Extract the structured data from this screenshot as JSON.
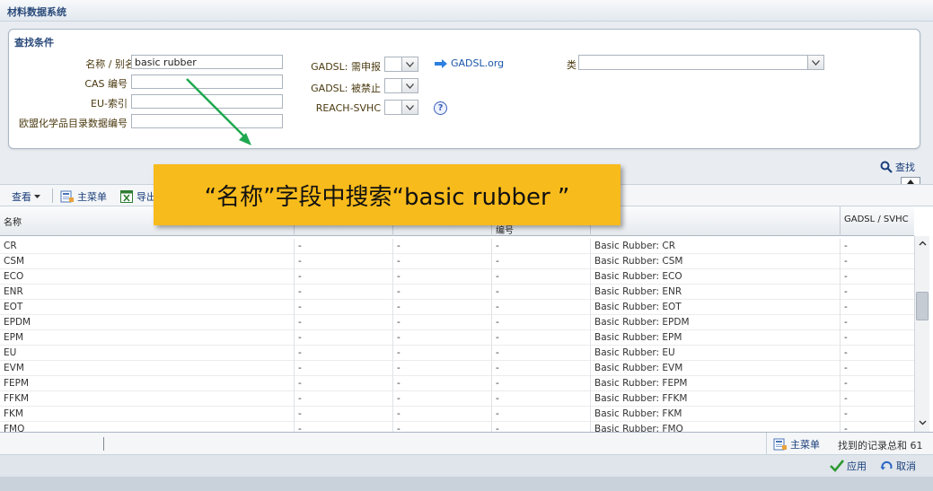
{
  "app": {
    "title": "材料数据系统"
  },
  "search": {
    "title": "查找条件",
    "name_label": "名称 / 别名",
    "name_value": "basic rubber",
    "cas_label": "CAS 编号",
    "eu_label": "EU-索引",
    "echa_label": "欧盟化学品目录数据编号",
    "gadsl_declare_label": "GADSL: 需申报",
    "gadsl_prohibited_label": "GADSL: 被禁止",
    "reach_label": "REACH-SVHC",
    "gadsl_link": "GADSL.org",
    "category_label": "类",
    "find_button": "查找"
  },
  "toolbar": {
    "view": "查看",
    "main_menu": "主菜单",
    "export": "导出"
  },
  "grid": {
    "headers": [
      "名称",
      "",
      "",
      "编号",
      "",
      "GADSL / SVHC"
    ],
    "rows": [
      [
        "CR",
        "-",
        "-",
        "-",
        "Basic Rubber: CR",
        "-"
      ],
      [
        "CSM",
        "-",
        "-",
        "-",
        "Basic Rubber: CSM",
        "-"
      ],
      [
        "ECO",
        "-",
        "-",
        "-",
        "Basic Rubber: ECO",
        "-"
      ],
      [
        "ENR",
        "-",
        "-",
        "-",
        "Basic Rubber: ENR",
        "-"
      ],
      [
        "EOT",
        "-",
        "-",
        "-",
        "Basic Rubber: EOT",
        "-"
      ],
      [
        "EPDM",
        "-",
        "-",
        "-",
        "Basic Rubber: EPDM",
        "-"
      ],
      [
        "EPM",
        "-",
        "-",
        "-",
        "Basic Rubber: EPM",
        "-"
      ],
      [
        "EU",
        "-",
        "-",
        "-",
        "Basic Rubber: EU",
        "-"
      ],
      [
        "EVM",
        "-",
        "-",
        "-",
        "Basic Rubber: EVM",
        "-"
      ],
      [
        "FEPM",
        "-",
        "-",
        "-",
        "Basic Rubber: FEPM",
        "-"
      ],
      [
        "FFKM",
        "-",
        "-",
        "-",
        "Basic Rubber: FFKM",
        "-"
      ],
      [
        "FKM",
        "-",
        "-",
        "-",
        "Basic Rubber: FKM",
        "-"
      ],
      [
        "FMQ",
        "-",
        "-",
        "-",
        "Basic Rubber: FMQ",
        "-"
      ]
    ]
  },
  "status": {
    "main_menu": "主菜单",
    "records_label": "找到的记录总和",
    "records_count": "61"
  },
  "footer": {
    "apply": "应用",
    "cancel": "取消"
  },
  "callout": {
    "text": "“名称”字段中搜索“basic rubber ”"
  },
  "colors": {
    "accent": "#1a3e7a",
    "callout": "#f8bb1c",
    "arrow": "#1fa84f"
  }
}
